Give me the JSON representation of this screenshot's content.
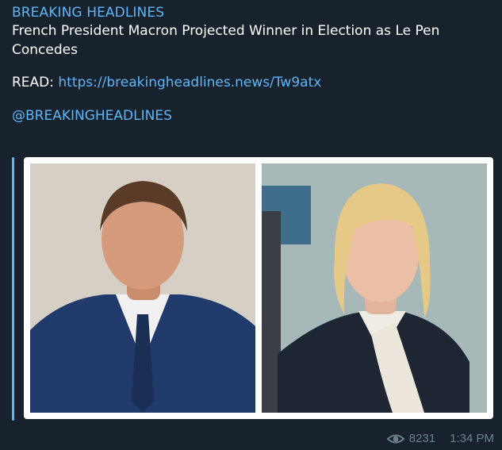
{
  "post": {
    "channel": "BREAKING HEADLINES",
    "headline": "French President Macron Projected Winner in Election as Le Pen Concedes",
    "read_prefix": "READ: ",
    "link": "https://breakingheadlines.news/Tw9atx",
    "mention": "@BREAKINGHEADLINES"
  },
  "media": {
    "left_photo_icon": "person-photo-icon",
    "right_photo_icon": "person-photo-icon"
  },
  "footer": {
    "views": "8231",
    "time": "1:34 PM",
    "views_icon": "eye-icon"
  },
  "colors": {
    "background": "#18222d",
    "accent": "#5eb5f7",
    "meta": "#6d7f8f"
  }
}
